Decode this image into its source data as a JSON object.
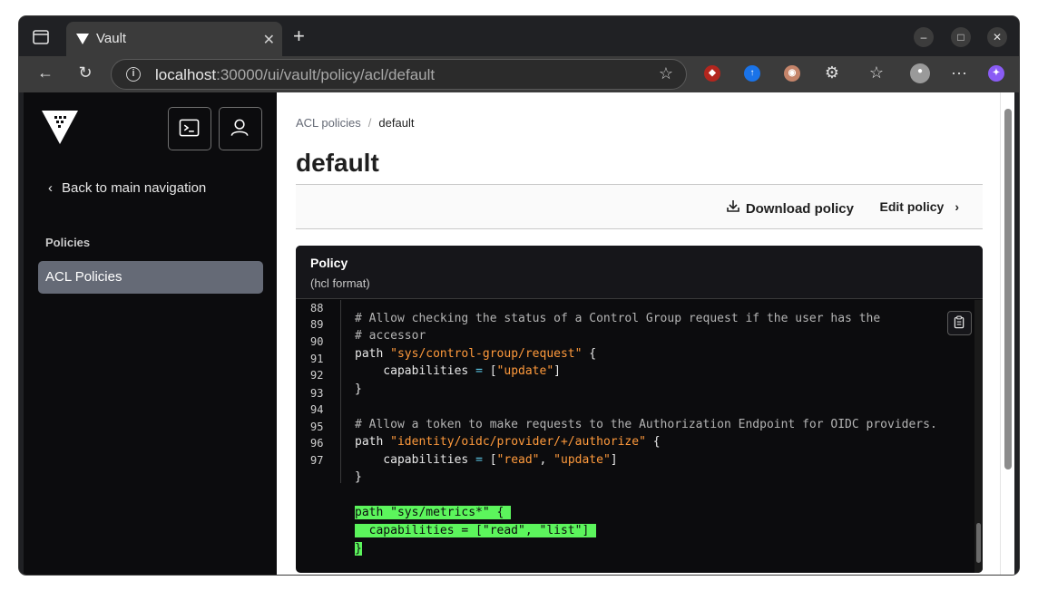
{
  "browser": {
    "tab_title": "Vault",
    "tab_close": "✕",
    "new_tab": "+",
    "url_host": "localhost",
    "url_path": ":30000/ui/vault/policy/acl/default",
    "window_min": "–",
    "window_max": "□",
    "window_close": "✕",
    "more_menu": "···"
  },
  "sidebar": {
    "back_label": "Back to main navigation",
    "section_label": "Policies",
    "items": [
      {
        "label": "ACL Policies",
        "active": true
      }
    ]
  },
  "breadcrumb": {
    "parent": "ACL policies",
    "separator": "/",
    "current": "default"
  },
  "page": {
    "title": "default",
    "download_label": "Download policy",
    "edit_label": "Edit policy"
  },
  "policy": {
    "title": "Policy",
    "subtitle": "(hcl format)",
    "line_numbers": [
      "88",
      "89",
      "90",
      "91",
      "92",
      "93",
      "94",
      "95",
      "96",
      "97"
    ],
    "lines": [
      {
        "parts": [
          {
            "cls": "cm",
            "text": "# Allow checking the status of a Control Group request if the user has the"
          }
        ]
      },
      {
        "parts": [
          {
            "cls": "cm",
            "text": "# accessor"
          }
        ]
      },
      {
        "parts": [
          {
            "cls": "",
            "text": "path "
          },
          {
            "cls": "str",
            "text": "\"sys/control-group/request\""
          },
          {
            "cls": "",
            "text": " {"
          }
        ]
      },
      {
        "parts": [
          {
            "cls": "",
            "text": "    capabilities "
          },
          {
            "cls": "op",
            "text": "="
          },
          {
            "cls": "",
            "text": " ["
          },
          {
            "cls": "str",
            "text": "\"update\""
          },
          {
            "cls": "",
            "text": "]"
          }
        ]
      },
      {
        "parts": [
          {
            "cls": "",
            "text": "}"
          }
        ]
      },
      {
        "parts": [
          {
            "cls": "",
            "text": ""
          }
        ]
      },
      {
        "parts": [
          {
            "cls": "cm",
            "text": "# Allow a token to make requests to the Authorization Endpoint for OIDC providers."
          }
        ]
      },
      {
        "parts": [
          {
            "cls": "",
            "text": "path "
          },
          {
            "cls": "str",
            "text": "\"identity/oidc/provider/+/authorize\""
          },
          {
            "cls": "",
            "text": " {"
          }
        ]
      },
      {
        "parts": [
          {
            "cls": "",
            "text": "    capabilities "
          },
          {
            "cls": "op",
            "text": "="
          },
          {
            "cls": "",
            "text": " ["
          },
          {
            "cls": "str",
            "text": "\"read\""
          },
          {
            "cls": "",
            "text": ", "
          },
          {
            "cls": "str",
            "text": "\"update\""
          },
          {
            "cls": "",
            "text": "]"
          }
        ]
      },
      {
        "parts": [
          {
            "cls": "",
            "text": "}"
          }
        ]
      },
      {
        "parts": [
          {
            "cls": "",
            "text": ""
          }
        ]
      },
      {
        "parts": [
          {
            "cls": "hl",
            "text": "path \"sys/metrics*\" { "
          }
        ]
      },
      {
        "parts": [
          {
            "cls": "hl",
            "text": "  capabilities = [\"read\", \"list\"] "
          }
        ]
      },
      {
        "parts": [
          {
            "cls": "hl",
            "text": "}"
          }
        ]
      }
    ]
  },
  "colors": {
    "sidebar_bg": "#0c0c0e",
    "active_item": "#656a76",
    "string": "#ff9a3c",
    "highlight": "#5cf55c"
  }
}
